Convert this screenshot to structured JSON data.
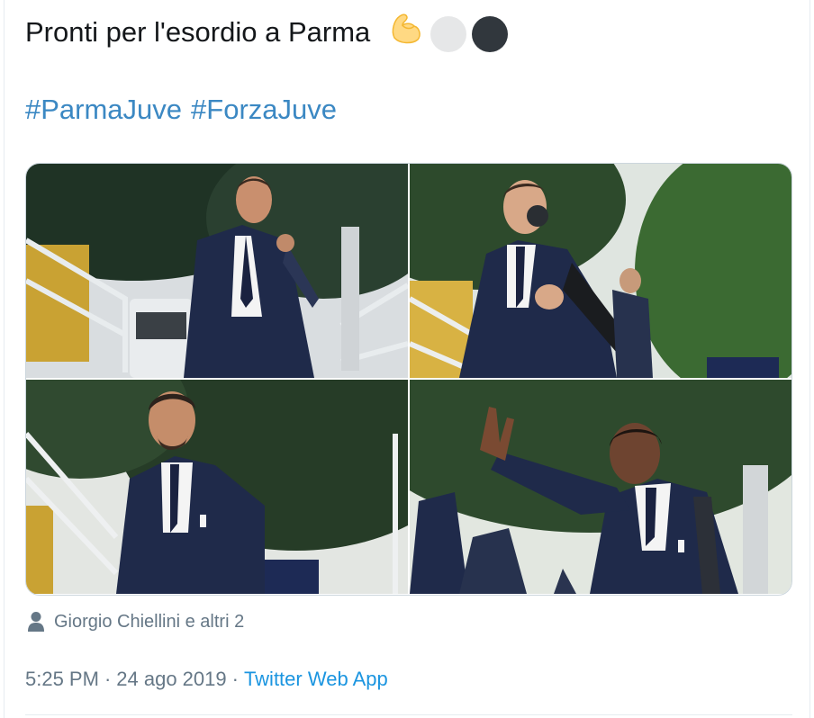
{
  "tweet": {
    "text": "Pronti per l'esordio a Parma",
    "emojis": [
      "flexed-biceps-icon",
      "white-circle-icon",
      "black-circle-icon"
    ],
    "hashtags": [
      "#ParmaJuve",
      "#ForzaJuve"
    ]
  },
  "media": [
    {
      "name": "photo-1"
    },
    {
      "name": "photo-2"
    },
    {
      "name": "photo-3"
    },
    {
      "name": "photo-4"
    }
  ],
  "likes": {
    "icon": "person-icon",
    "text": "Giorgio Chiellini e altri 2"
  },
  "meta": {
    "time": "5:25 PM",
    "separator": "·",
    "date": "24 ago 2019",
    "source": "Twitter Web App"
  },
  "colors": {
    "hashtag": "#3b88c3",
    "link": "#1b95e0",
    "muted": "#657786",
    "suit": "#1f2a4a"
  }
}
